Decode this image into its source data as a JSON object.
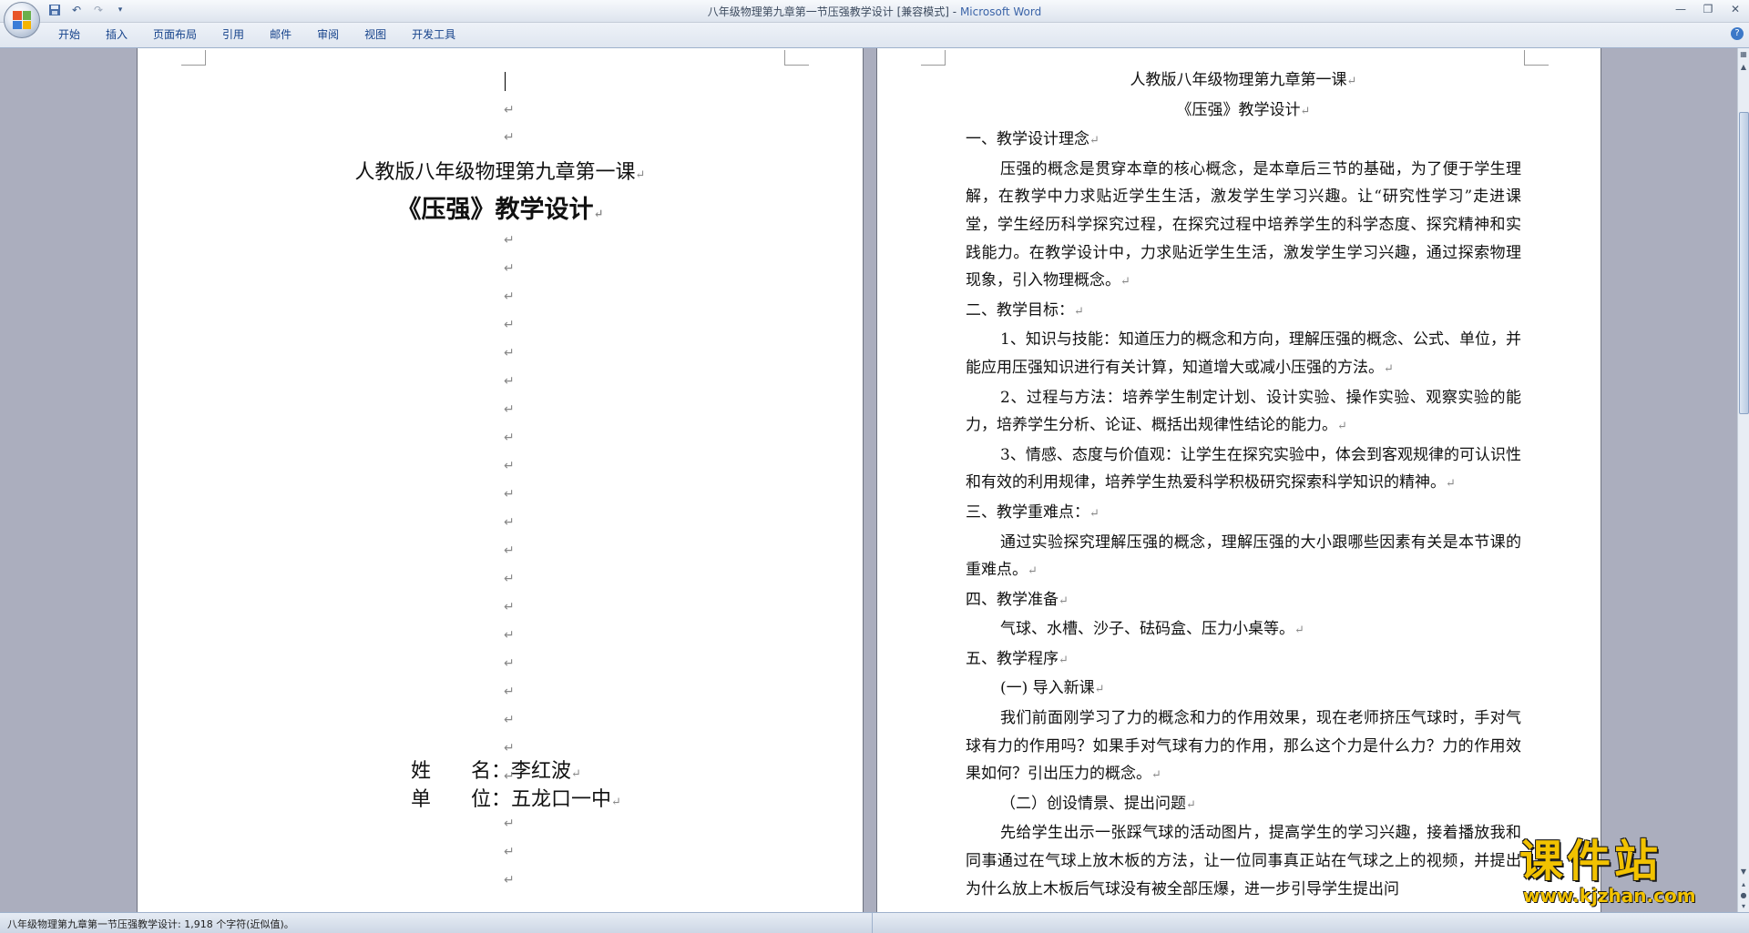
{
  "window": {
    "doc_title": "八年级物理第九章第一节压强教学设计 [兼容模式]",
    "separator": " - ",
    "app_name": "Microsoft Word"
  },
  "ribbon": {
    "tabs": [
      "开始",
      "插入",
      "页面布局",
      "引用",
      "邮件",
      "审阅",
      "视图",
      "开发工具"
    ]
  },
  "page1": {
    "course": "人教版八年级物理第九章第一课",
    "title": "《压强》教学设计",
    "name_label": "姓　　名：",
    "name_value": "李红波",
    "unit_label": "单　　位：",
    "unit_value": "五龙口一中"
  },
  "page2": {
    "heading1": "人教版八年级物理第九章第一课",
    "heading2": "《压强》教学设计",
    "s1": "一、教学设计理念",
    "p1": "压强的概念是贯穿本章的核心概念，是本章后三节的基础，为了便于学生理解，在教学中力求贴近学生生活，激发学生学习兴趣。让“研究性学习”走进课堂，学生经历科学探究过程，在探究过程中培养学生的科学态度、探究精神和实践能力。在教学设计中，力求贴近学生生活，激发学生学习兴趣，通过探索物理现象，引入物理概念。",
    "s2": "二、教学目标：",
    "g1": "1、知识与技能：知道压力的概念和方向，理解压强的概念、公式、单位，并能应用压强知识进行有关计算，知道增大或减小压强的方法。",
    "g2": "2、过程与方法：培养学生制定计划、设计实验、操作实验、观察实验的能力，培养学生分析、论证、概括出规律性结论的能力。",
    "g3": "3、情感、态度与价值观：让学生在探究实验中，体会到客观规律的可认识性和有效的利用规律，培养学生热爱科学积极研究探索科学知识的精神。",
    "s3": "三、教学重难点：",
    "p3": "通过实验探究理解压强的概念，理解压强的大小跟哪些因素有关是本节课的重难点。",
    "s4": "四、教学准备",
    "p4": "气球、水槽、沙子、砝码盒、压力小桌等。",
    "s5": "五、教学程序",
    "sub1": "(一) 导入新课",
    "p5": "我们前面刚学习了力的概念和力的作用效果，现在老师挤压气球时，手对气球有力的作用吗？如果手对气球有力的作用，那么这个力是什么力？力的作用效果如何？引出压力的概念。",
    "sub2": "（二）创设情景、提出问题",
    "p6": "先给学生出示一张踩气球的活动图片，提高学生的学习兴趣，接着播放我和同事通过在气球上放木板的方法，让一位同事真正站在气球之上的视频，并提出为什么放上木板后气球没有被全部压爆，进一步引导学生提出问"
  },
  "status": {
    "text": "八年级物理第九章第一节压强教学设计: 1,918 个字符(近似值)。"
  },
  "watermark": {
    "cn": "课件站",
    "url": "www.kjzhan.com"
  },
  "colors": {
    "workspace": "#abaebe",
    "ribbon_text": "#15428b",
    "watermark": "#f2c200"
  }
}
